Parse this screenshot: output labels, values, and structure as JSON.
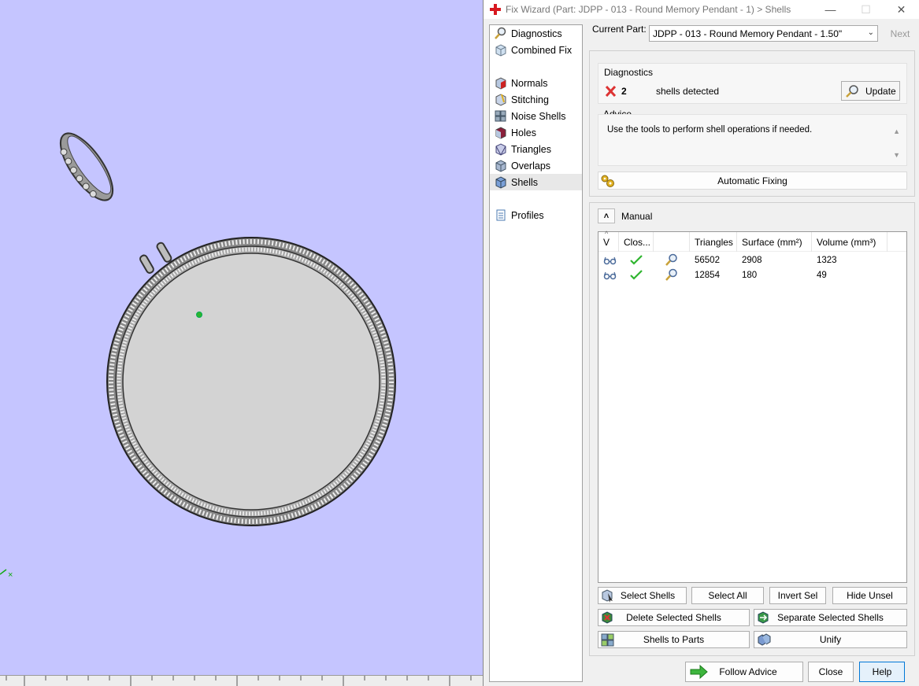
{
  "window": {
    "title": "Fix Wizard (Part: JDPP - 013 - Round Memory Pendant - 1) > Shells",
    "minimize": "—",
    "maximize": "☐",
    "close": "✕"
  },
  "nav": {
    "items": [
      {
        "label": "Diagnostics",
        "icon": "magnifier-icon"
      },
      {
        "label": "Combined Fix",
        "icon": "cube-icon"
      },
      {
        "label": "Normals",
        "icon": "normals-cube-icon"
      },
      {
        "label": "Stitching",
        "icon": "stitching-cube-icon"
      },
      {
        "label": "Noise Shells",
        "icon": "noise-cube-icon"
      },
      {
        "label": "Holes",
        "icon": "holes-cube-icon"
      },
      {
        "label": "Triangles",
        "icon": "triangles-cube-icon"
      },
      {
        "label": "Overlaps",
        "icon": "overlaps-cube-icon"
      },
      {
        "label": "Shells",
        "icon": "shells-cube-icon",
        "selected": true
      },
      {
        "label": "Profiles",
        "icon": "document-icon"
      }
    ]
  },
  "current_part": {
    "label": "Current Part:",
    "value": "JDPP - 013 - Round Memory Pendant - 1.50\"",
    "next": "Next"
  },
  "diagnostics": {
    "label": "Diagnostics",
    "count": "2",
    "message": "shells detected",
    "update": "Update"
  },
  "advice": {
    "label": "Advice",
    "text": "Use the tools to perform shell operations if needed."
  },
  "automatic_fixing": "Automatic Fixing",
  "manual": {
    "label": "Manual",
    "columns": [
      "V",
      "Clos...",
      "",
      "Triangles",
      "Surface (mm²)",
      "Volume (mm³)"
    ],
    "rows": [
      {
        "triangles": "56502",
        "surface": "2908",
        "volume": "1323"
      },
      {
        "triangles": "12854",
        "surface": "180",
        "volume": "49"
      }
    ],
    "buttons": {
      "select_shells": "Select Shells",
      "select_all": "Select All",
      "invert_sel": "Invert Sel",
      "hide_unsel": "Hide Unsel",
      "delete_selected": "Delete Selected Shells",
      "separate_selected": "Separate Selected Shells",
      "shells_to_parts": "Shells to Parts",
      "unify": "Unify"
    }
  },
  "footer": {
    "follow_advice": "Follow Advice",
    "close": "Close",
    "help": "Help"
  },
  "colors": {
    "viewport_bg": "#c5c5ff",
    "dialog_bg": "#f0f0f0",
    "accent": "#0078d7",
    "check_green": "#2fb52f",
    "error_red": "#d33"
  }
}
